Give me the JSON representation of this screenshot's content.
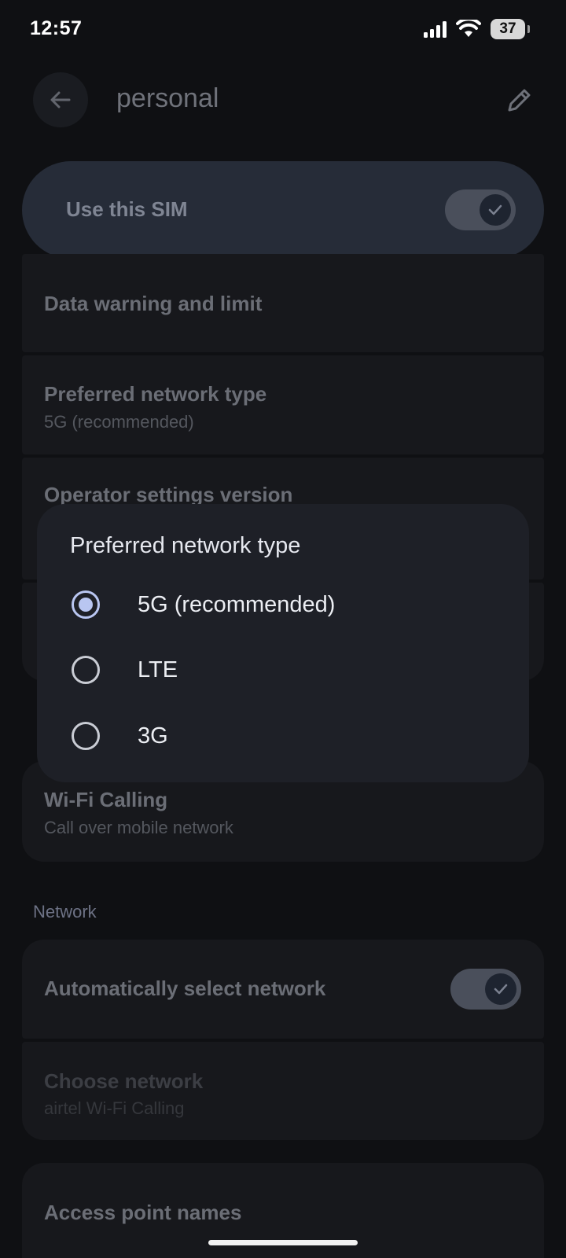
{
  "status_bar": {
    "time": "12:57",
    "battery": "37"
  },
  "header": {
    "title": "personal",
    "back_icon": "arrow-left-icon",
    "edit_icon": "pencil-icon"
  },
  "sim": {
    "label": "Use this SIM",
    "enabled": true
  },
  "settings": {
    "data_warning": {
      "title": "Data warning and limit"
    },
    "preferred_network": {
      "title": "Preferred network type",
      "subtitle": "5G (recommended)"
    },
    "operator_version": {
      "title": "Operator settings version"
    },
    "wifi_calling": {
      "title": "Wi-Fi Calling",
      "subtitle": "Call over mobile network"
    }
  },
  "network_section": {
    "header": "Network",
    "auto_select": {
      "title": "Automatically select network",
      "enabled": true
    },
    "choose_network": {
      "title": "Choose network",
      "subtitle": "airtel Wi-Fi Calling"
    },
    "apn": {
      "title": "Access point names"
    }
  },
  "dialog": {
    "title": "Preferred network type",
    "options": [
      {
        "label": "5G (recommended)",
        "selected": true
      },
      {
        "label": "LTE",
        "selected": false
      },
      {
        "label": "3G",
        "selected": false
      }
    ]
  },
  "colors": {
    "background": "#0f1013",
    "dialog": "#1e2027",
    "accent": "#b9c6f1",
    "sim_card": "#262c38"
  }
}
